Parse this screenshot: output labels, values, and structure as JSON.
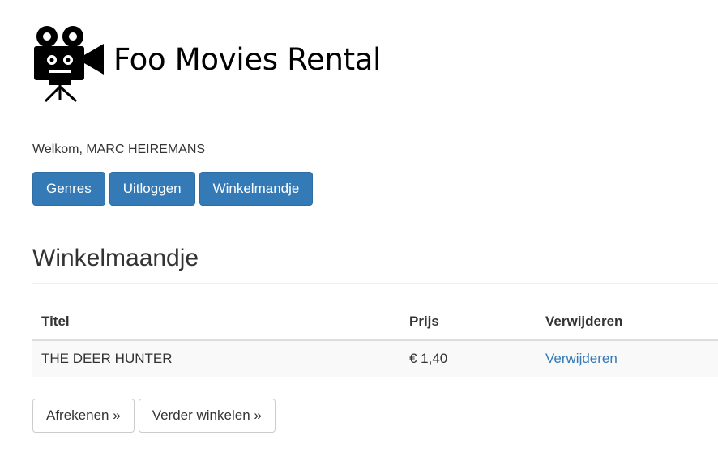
{
  "header": {
    "logo_text": "Foo Movies Rental",
    "logo_icon": "movie-camera-icon"
  },
  "welcome": {
    "prefix": "Welkom, ",
    "user": "MARC HEIREMANS"
  },
  "nav": {
    "genres_label": "Genres",
    "logout_label": "Uitloggen",
    "cart_label": "Winkelmandje"
  },
  "cart": {
    "heading": "Winkelmaandje",
    "columns": {
      "title": "Titel",
      "price": "Prijs",
      "remove": "Verwijderen"
    },
    "rows": [
      {
        "title": "THE DEER HUNTER",
        "price": "€ 1,40",
        "remove_label": "Verwijderen"
      }
    ]
  },
  "actions": {
    "checkout_label": "Afrekenen »",
    "continue_label": "Verder winkelen »"
  },
  "colors": {
    "primary": "#337ab7",
    "link": "#337ab7",
    "text": "#333333"
  }
}
